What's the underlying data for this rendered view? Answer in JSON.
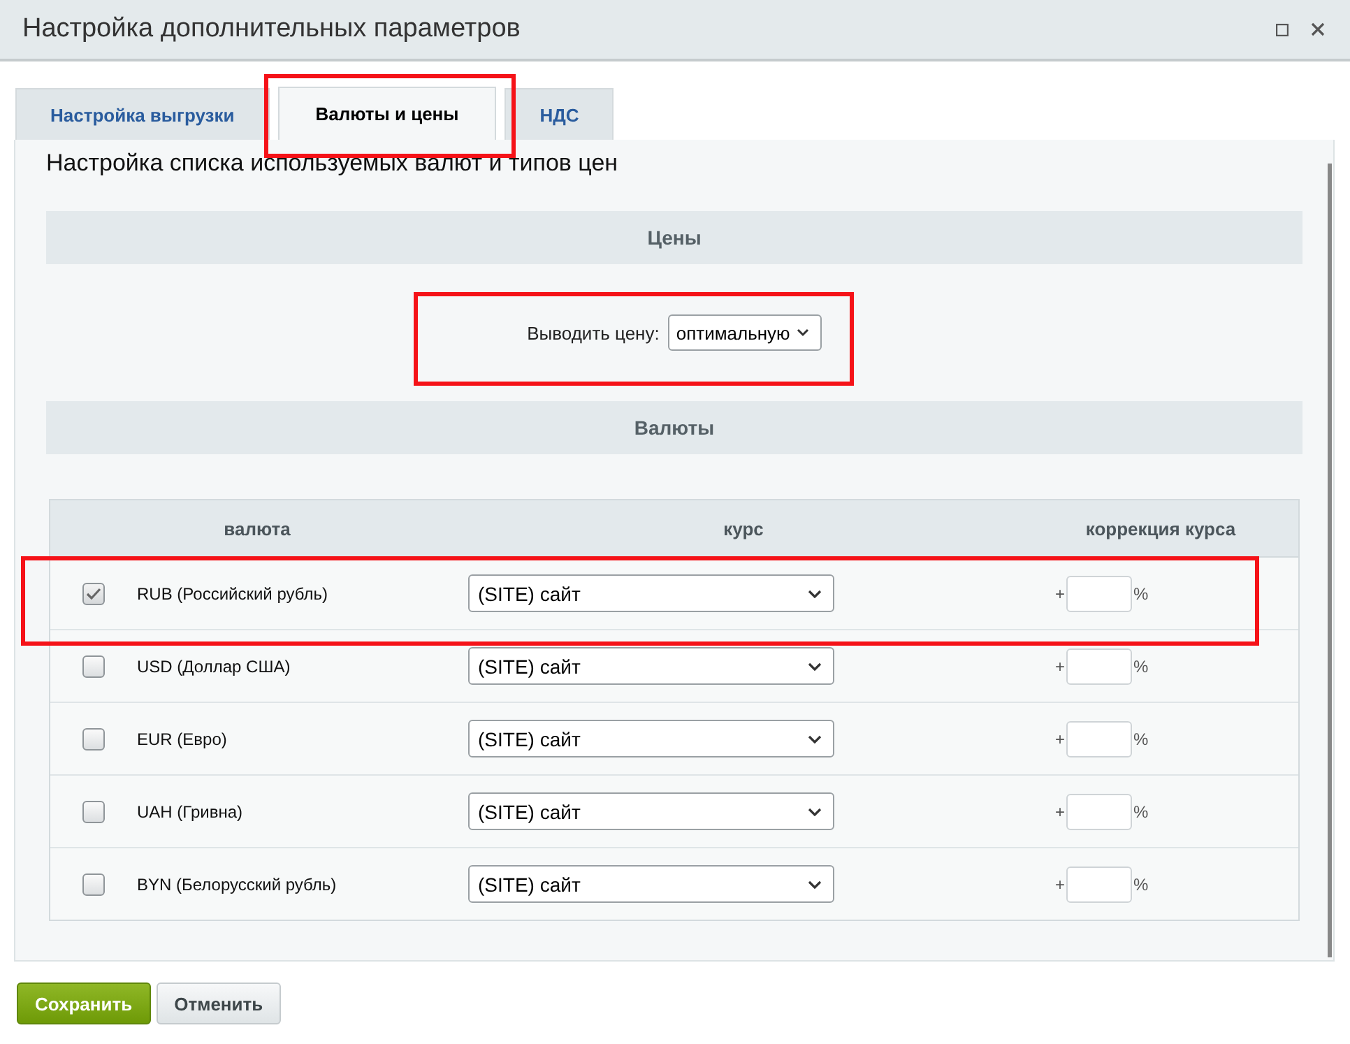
{
  "window": {
    "title": "Настройка дополнительных параметров"
  },
  "tabs": [
    {
      "label": "Настройка выгрузки",
      "selected": false
    },
    {
      "label": "Валюты и цены",
      "selected": true
    },
    {
      "label": "НДС",
      "selected": false
    }
  ],
  "heading": "Настройка списка используемых валют и типов цен",
  "prices_section": {
    "title": "Цены",
    "label": "Выводить цену:",
    "value": "оптимальную"
  },
  "currencies_section": {
    "title": "Валюты"
  },
  "table": {
    "columns": [
      "валюта",
      "курс",
      "коррекция курса"
    ],
    "rows": [
      {
        "checked": true,
        "currency": "RUB (Российский рубль)",
        "rate": "(SITE) сайт",
        "plus": "+",
        "percent": "%"
      },
      {
        "checked": false,
        "currency": "USD (Доллар США)",
        "rate": "(SITE) сайт",
        "plus": "+",
        "percent": "%"
      },
      {
        "checked": false,
        "currency": "EUR (Евро)",
        "rate": "(SITE) сайт",
        "plus": "+",
        "percent": "%"
      },
      {
        "checked": false,
        "currency": "UAH (Гривна)",
        "rate": "(SITE) сайт",
        "plus": "+",
        "percent": "%"
      },
      {
        "checked": false,
        "currency": "BYN (Белорусский рубль)",
        "rate": "(SITE) сайт",
        "plus": "+",
        "percent": "%"
      }
    ]
  },
  "buttons": [
    {
      "label": "Сохранить",
      "kind": "primary"
    },
    {
      "label": "Отменить",
      "kind": "secondary"
    }
  ]
}
